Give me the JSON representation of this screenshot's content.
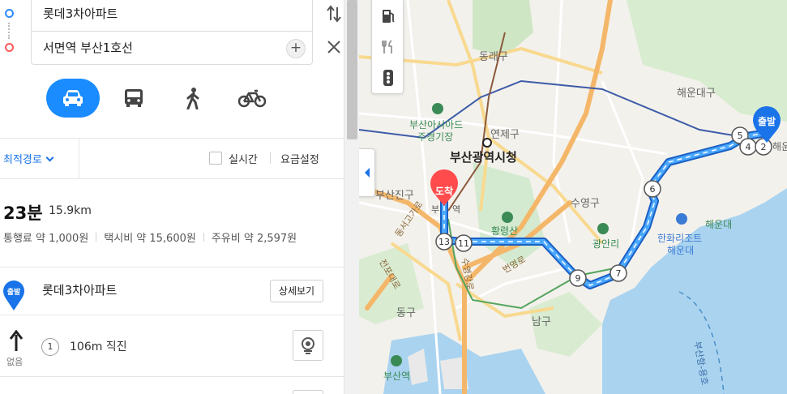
{
  "route_inputs": {
    "start": "롯데3차아파트",
    "end": "서면역 부산1호선"
  },
  "options": {
    "sort_label": "최적경로",
    "realtime_label": "실시간",
    "fare_settings_label": "요금설정"
  },
  "summary": {
    "time": "23분",
    "distance": "15.9km",
    "toll": "통행료 약 1,000원",
    "taxi": "택시비 약 15,600원",
    "fuel": "주유비 약 2,597원"
  },
  "steps": {
    "start_badge": "출발",
    "start_name": "롯데3차아파트",
    "detail_button": "상세보기",
    "step1_number": "1",
    "step1_text": "106m 직진",
    "step1_sub": "없음"
  },
  "map": {
    "labels": {
      "dongraegu": "동래구",
      "haeundaegu": "해운대구",
      "busan_asiad": "부산아시아드",
      "jugyeong": "주경기장",
      "yeonjegu": "연제구",
      "cityhall": "부산광역시청",
      "busanjingu": "부산진구",
      "suyeonggu": "수영구",
      "hwangryeongsan": "황령산",
      "haeundae": "해운대",
      "gwangalli": "광안리",
      "hanwha_resort_1": "한화리조트",
      "hanwha_resort_2": "해운대",
      "donggu": "동구",
      "namgu": "남구",
      "busan_station": "부산역",
      "dongseo_road": "동서고가로",
      "buyeonro_1": "부",
      "buyeonro_2": "역",
      "jeonpo_road": "전포대로",
      "beonyeong_road": "번영로",
      "suyeong_road": "수영강로",
      "haeun_partial": "해운",
      "ocean_route": "부산항-용호",
      "busanjin_stn": "부산진구"
    },
    "markers": {
      "start": "출발",
      "end": "도착"
    },
    "waypoints": [
      "2",
      "4",
      "5",
      "6",
      "7",
      "9",
      "11",
      "13"
    ],
    "colors": {
      "route": "#1a8cff",
      "start_marker": "#1a73e8",
      "end_marker": "#ff4b4b",
      "sea": "#aad3ef",
      "highway": "#f4b76a"
    }
  },
  "icons": {
    "swap": "swap-icon",
    "close": "close-icon",
    "add": "plus-icon",
    "car": "car-icon",
    "bus": "bus-icon",
    "walk": "walk-icon",
    "bike": "bike-icon",
    "gas": "gas-station-icon",
    "food": "restaurant-icon",
    "traffic": "traffic-light-icon"
  }
}
